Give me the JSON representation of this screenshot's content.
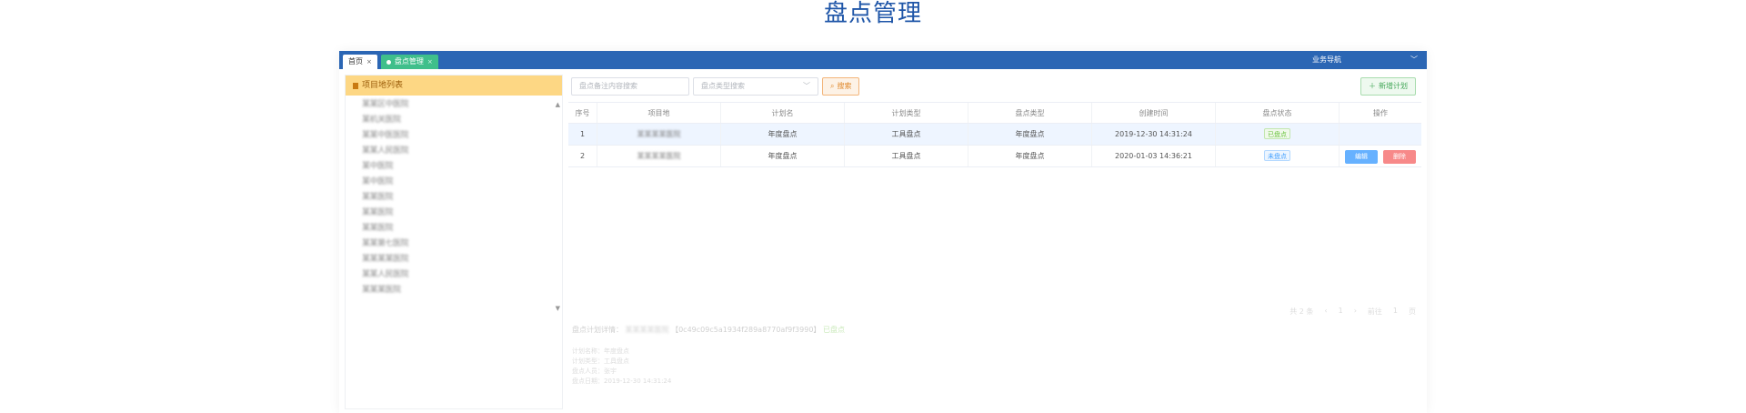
{
  "page": {
    "title": "盘点管理"
  },
  "tabs": {
    "home": "首页",
    "active": "盘点管理",
    "close": "×"
  },
  "nav": {
    "label": "业务导航",
    "chevron": "﹀"
  },
  "sidebar": {
    "title": "项目地列表",
    "items": [
      "某某区中医院",
      "某机关医院",
      "某某中医医院",
      "某某人民医院",
      "某中医院",
      "某中医院",
      "某某医院",
      "某某医院",
      "某某医院",
      "某某第七医院",
      "某某某某医院",
      "某某人民医院",
      "某某某医院"
    ]
  },
  "toolbar": {
    "search_placeholder": "盘点备注内容搜索",
    "type_placeholder": "盘点类型搜索",
    "search_btn": "搜索",
    "add_btn": "新增计划"
  },
  "table": {
    "headers": [
      "序号",
      "项目地",
      "计划名",
      "计划类型",
      "盘点类型",
      "创建时间",
      "盘点状态",
      "操作"
    ],
    "rows": [
      {
        "index": "1",
        "site": "某某某某医院",
        "plan_name": "年度盘点",
        "plan_type": "工具盘点",
        "check_type": "年度盘点",
        "created": "2019-12-30 14:31:24",
        "status": "已盘点",
        "status_kind": "done"
      },
      {
        "index": "2",
        "site": "某某某某医院",
        "plan_name": "年度盘点",
        "plan_type": "工具盘点",
        "check_type": "年度盘点",
        "created": "2020-01-03 14:36:21",
        "status": "未盘点",
        "status_kind": "undone",
        "edit": "编辑",
        "delete": "删除"
      }
    ]
  },
  "pager": {
    "total": "共 2 条",
    "prev": "‹",
    "page": "1",
    "next": "›",
    "goto": "前往",
    "page_input": "1",
    "unit": "页"
  },
  "detail": {
    "label": "盘点计划详情：",
    "site": "某某某某医院",
    "id": "【0c49c09c5a1934f289a8770af9f3990】",
    "status": "已盘点",
    "lines": [
      "计划名称：年度盘点",
      "计划类型：工具盘点",
      "盘点人员：张宇",
      "盘点日期：2019-12-30 14:31:24"
    ]
  }
}
